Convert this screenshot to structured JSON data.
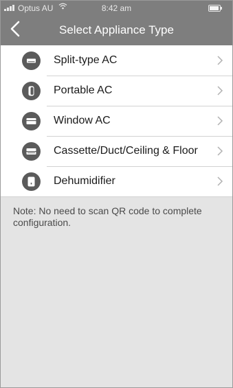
{
  "status_bar": {
    "carrier": "Optus AU",
    "time": "8:42 am",
    "icons": [
      "signal-bars-icon",
      "wifi-icon",
      "battery-icon"
    ]
  },
  "nav": {
    "title": "Select Appliance Type",
    "back_icon": "chevron-left-icon"
  },
  "appliances": [
    {
      "label": "Split-type AC",
      "icon": "split-ac-icon"
    },
    {
      "label": "Portable AC",
      "icon": "portable-ac-icon"
    },
    {
      "label": "Window AC",
      "icon": "window-ac-icon"
    },
    {
      "label": "Cassette/Duct/Ceiling & Floor",
      "icon": "cassette-ac-icon"
    },
    {
      "label": "Dehumidifier",
      "icon": "dehumidifier-icon"
    }
  ],
  "note": "Note: No need to scan QR code to complete configuration.",
  "colors": {
    "nav_background": "#7e7e7e",
    "page_background": "#e4e4e4",
    "icon_background": "#5b5b5b"
  }
}
